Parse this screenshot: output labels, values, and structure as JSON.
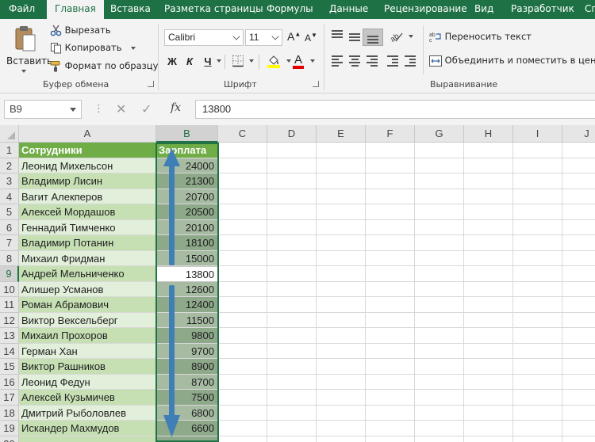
{
  "ribbon_tabs": [
    "Файл",
    "Главная",
    "Вставка",
    "Разметка страницы",
    "Формулы",
    "Данные",
    "Рецензирование",
    "Вид",
    "Разработчик",
    "Сп"
  ],
  "active_tab": "Главная",
  "clipboard": {
    "paste_label": "Вставить",
    "cut_label": "Вырезать",
    "copy_label": "Копировать",
    "format_painter_label": "Формат по образцу",
    "group_label": "Буфер обмена"
  },
  "font": {
    "name": "Calibri",
    "size": "11",
    "bold": "Ж",
    "italic": "К",
    "underline": "Ч",
    "grow": "A",
    "shrink": "A",
    "font_color_letter": "A",
    "group_label": "Шрифт"
  },
  "alignment": {
    "wrap_text_label": "Переносить текст",
    "merge_center_label": "Объединить и поместить в центре",
    "group_label": "Выравнивание"
  },
  "formula_bar": {
    "name_box": "B9",
    "fx": "fx",
    "value": "13800"
  },
  "columns": [
    "A",
    "B",
    "C",
    "D",
    "E",
    "F",
    "G",
    "H",
    "I",
    "J"
  ],
  "selected_column": "B",
  "selected_row": 9,
  "header_row": [
    "Сотрудники",
    "Зарплата"
  ],
  "rows": [
    {
      "n": "2",
      "name": "Леонид Михельсон",
      "salary": "24000"
    },
    {
      "n": "3",
      "name": "Владимир Лисин",
      "salary": "21300"
    },
    {
      "n": "4",
      "name": "Вагит Алекперов",
      "salary": "20700"
    },
    {
      "n": "5",
      "name": "Алексей Мордашов",
      "salary": "20500"
    },
    {
      "n": "6",
      "name": "Геннадий Тимченко",
      "salary": "20100"
    },
    {
      "n": "7",
      "name": "Владимир Потанин",
      "salary": "18100"
    },
    {
      "n": "8",
      "name": "Михаил Фридман",
      "salary": "15000"
    },
    {
      "n": "9",
      "name": "Андрей Мельниченко",
      "salary": "13800"
    },
    {
      "n": "10",
      "name": "Алишер Усманов",
      "salary": "12600"
    },
    {
      "n": "11",
      "name": "Роман Абрамович",
      "salary": "12400"
    },
    {
      "n": "12",
      "name": "Виктор Вексельберг",
      "salary": "11500"
    },
    {
      "n": "13",
      "name": "Михаил Прохоров",
      "salary": "9800"
    },
    {
      "n": "14",
      "name": "Герман Хан",
      "salary": "9700"
    },
    {
      "n": "15",
      "name": "Виктор Рашников",
      "salary": "8900"
    },
    {
      "n": "16",
      "name": "Леонид Федун",
      "salary": "8700"
    },
    {
      "n": "17",
      "name": "Алексей Кузьмичев",
      "salary": "7500"
    },
    {
      "n": "18",
      "name": "Дмитрий Рыболовлев",
      "salary": "6800"
    },
    {
      "n": "19",
      "name": "Искандер Махмудов",
      "salary": "6600"
    }
  ],
  "colors": {
    "excel_green": "#217346",
    "header_fill": "#70ad47",
    "band_light_a": "#e2efda",
    "band_dark_a": "#c6e0b4",
    "arrow": "#3f7fb6"
  },
  "icons": [
    "paste-icon",
    "scissors-icon",
    "copy-icon",
    "format-painter-icon",
    "borders-icon",
    "fill-color-icon",
    "orientation-icon",
    "wrap-text-icon",
    "merge-icon",
    "cancel-icon",
    "enter-icon",
    "fx-icon",
    "up-arrow-icon",
    "down-arrow-icon"
  ]
}
